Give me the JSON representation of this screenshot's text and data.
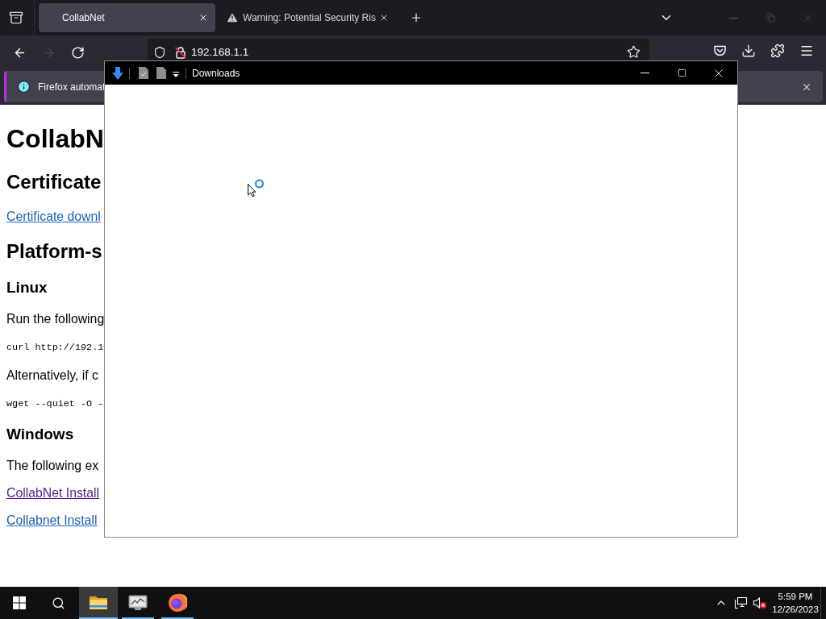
{
  "browser": {
    "tabs": [
      {
        "kind": "page",
        "title": "CollabNet",
        "selected": true
      },
      {
        "kind": "warning",
        "title": "Warning: Potential Security Ris",
        "selected": false
      }
    ],
    "navigation": [
      {
        "kind": "back",
        "disabled": false
      },
      {
        "kind": "forward",
        "disabled": true
      },
      {
        "kind": "reload",
        "disabled": false
      }
    ],
    "address_bar": {
      "url": "192.168.1.1"
    },
    "notification": {
      "text": "Firefox automat"
    }
  },
  "page": {
    "blocks": [
      {
        "kind": "h1",
        "text": "CollabN"
      },
      {
        "kind": "h2",
        "text": "Certificate"
      },
      {
        "kind": "link",
        "text": "Certificate downl",
        "visited": false
      },
      {
        "kind": "h2",
        "text": "Platform-s"
      },
      {
        "kind": "h3",
        "text": "Linux"
      },
      {
        "kind": "p",
        "text": "Run the following"
      },
      {
        "kind": "code",
        "text": "curl http://192.1"
      },
      {
        "kind": "p",
        "text": "Alternatively, if c"
      },
      {
        "kind": "code",
        "text": "wget --quiet -O -"
      },
      {
        "kind": "h3",
        "text": "Windows"
      },
      {
        "kind": "p",
        "text": "The following ex"
      },
      {
        "kind": "link",
        "text": "CollabNet Install",
        "visited": true
      },
      {
        "kind": "link",
        "text": "Collabnet Install",
        "visited": false
      }
    ]
  },
  "downloads_window": {
    "title": "Downloads"
  },
  "taskbar": {
    "apps": [
      {
        "kind": "explorer",
        "selected": true
      },
      {
        "kind": "monitor",
        "selected": false
      },
      {
        "kind": "browser",
        "selected": false
      }
    ],
    "clock": {
      "time": "5:59 PM",
      "date": "12/26/2023"
    }
  }
}
